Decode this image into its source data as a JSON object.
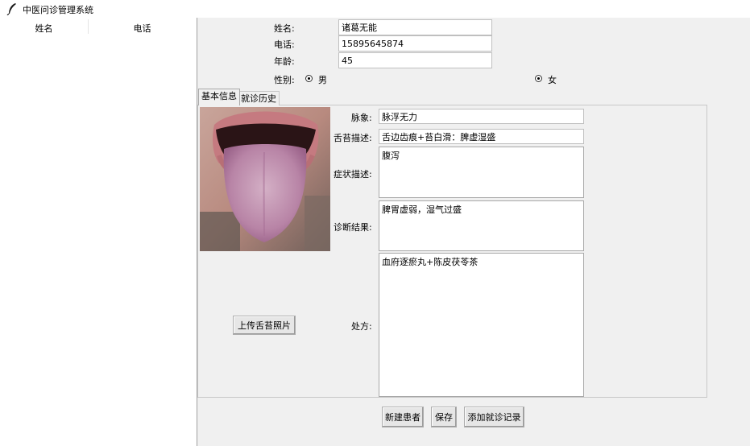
{
  "window": {
    "title": "中医问诊管理系统",
    "icon": "feather-icon"
  },
  "patient_list": {
    "columns": [
      "姓名",
      "电话"
    ],
    "rows": []
  },
  "form": {
    "name_label": "姓名:",
    "name_value": "诸葛无能",
    "phone_label": "电话:",
    "phone_value": "15895645874",
    "age_label": "年龄:",
    "age_value": "45",
    "gender_label": "性别:",
    "gender_male": "男",
    "gender_female": "女",
    "gender_selected": "both"
  },
  "tabs": [
    {
      "label": "基本信息",
      "active": true
    },
    {
      "label": "就诊历史",
      "active": false
    }
  ],
  "basic_info": {
    "pulse_label": "脉象:",
    "pulse_value": "脉浮无力",
    "tongue_label": "舌苔描述:",
    "tongue_value": "舌边齿痕+苔白滑：脾虚湿盛",
    "symptom_label": "症状描述:",
    "symptom_value": "腹泻",
    "diagnosis_label": "诊断结果:",
    "diagnosis_value": "脾胃虚弱，湿气过盛",
    "prescription_label": "处方:",
    "prescription_value": "血府逐瘀丸+陈皮茯苓茶",
    "upload_button": "上传舌苔照片"
  },
  "actions": {
    "new_patient": "新建患者",
    "save": "保存",
    "add_visit": "添加就诊记录"
  }
}
